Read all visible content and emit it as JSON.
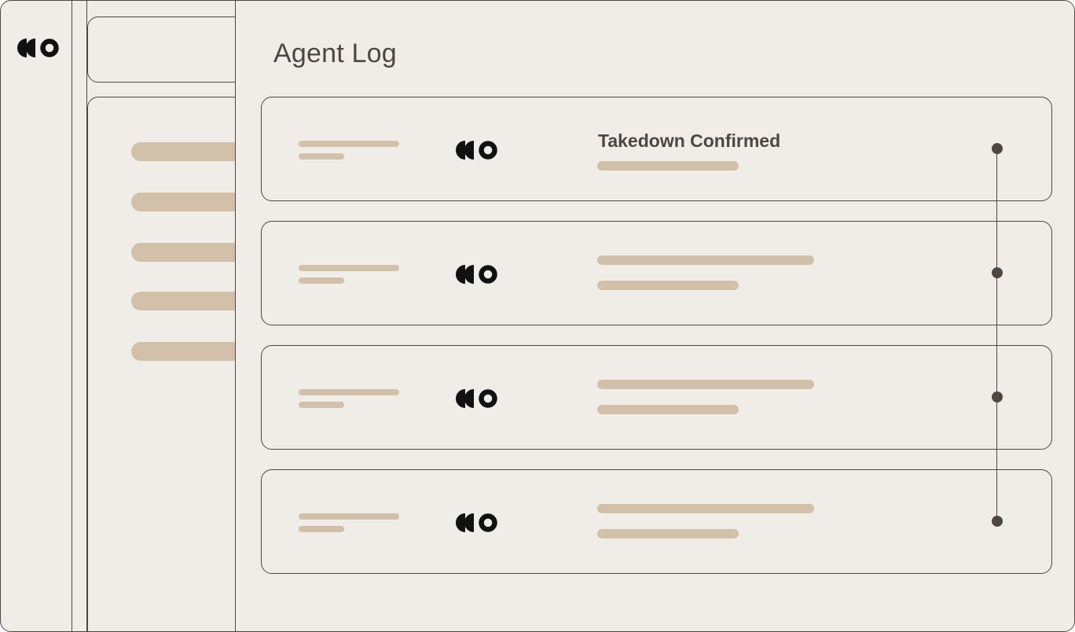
{
  "app": {
    "logo_icon": "brand-logo-icon"
  },
  "theme": {
    "background": "#f0ede8",
    "border": "#4d473f",
    "placeholder": "#d2c0aa",
    "text": "#4d473f"
  },
  "main": {
    "title": "Agent Log"
  },
  "log_entries": [
    {
      "title": "Takedown Confirmed",
      "agent_icon": "brand-logo-icon"
    },
    {
      "title": "",
      "agent_icon": "brand-logo-icon"
    },
    {
      "title": "",
      "agent_icon": "brand-logo-icon"
    },
    {
      "title": "",
      "agent_icon": "brand-logo-icon"
    }
  ]
}
